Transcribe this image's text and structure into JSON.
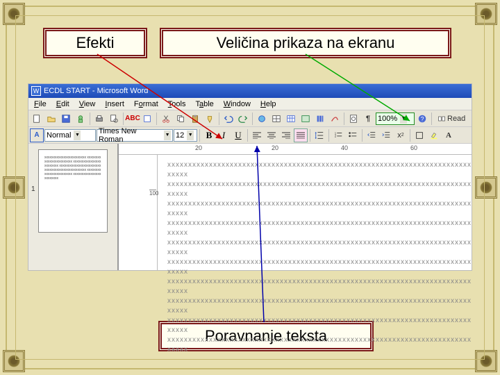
{
  "labels": {
    "effects": "Efekti",
    "zoom": "Veličina prikaza na ekranu",
    "align": "Poravnanje teksta"
  },
  "word": {
    "title": "ECDL START - Microsoft Word",
    "menu": {
      "file": "File",
      "edit": "Edit",
      "view": "View",
      "insert": "Insert",
      "format": "Format",
      "tools": "Tools",
      "table": "Table",
      "window": "Window",
      "help": "Help"
    },
    "style": "Normal",
    "font": "Times New Roman",
    "size": "12",
    "zoom": "100%",
    "read": "Read",
    "bold": "B",
    "italic": "I",
    "underline": "U",
    "ruler": {
      "t20": "20",
      "t40": "40",
      "t60": "60",
      "t100": "100"
    },
    "thumb_num": "1",
    "doc_line": "xxxxxxxxxxxxxxxxxxxxxxxxxxxxxxxxxxxxxxxxxxxxxxxxxxxxxxxxxxxxxxxxxxxxxxxxxxxxxx"
  }
}
